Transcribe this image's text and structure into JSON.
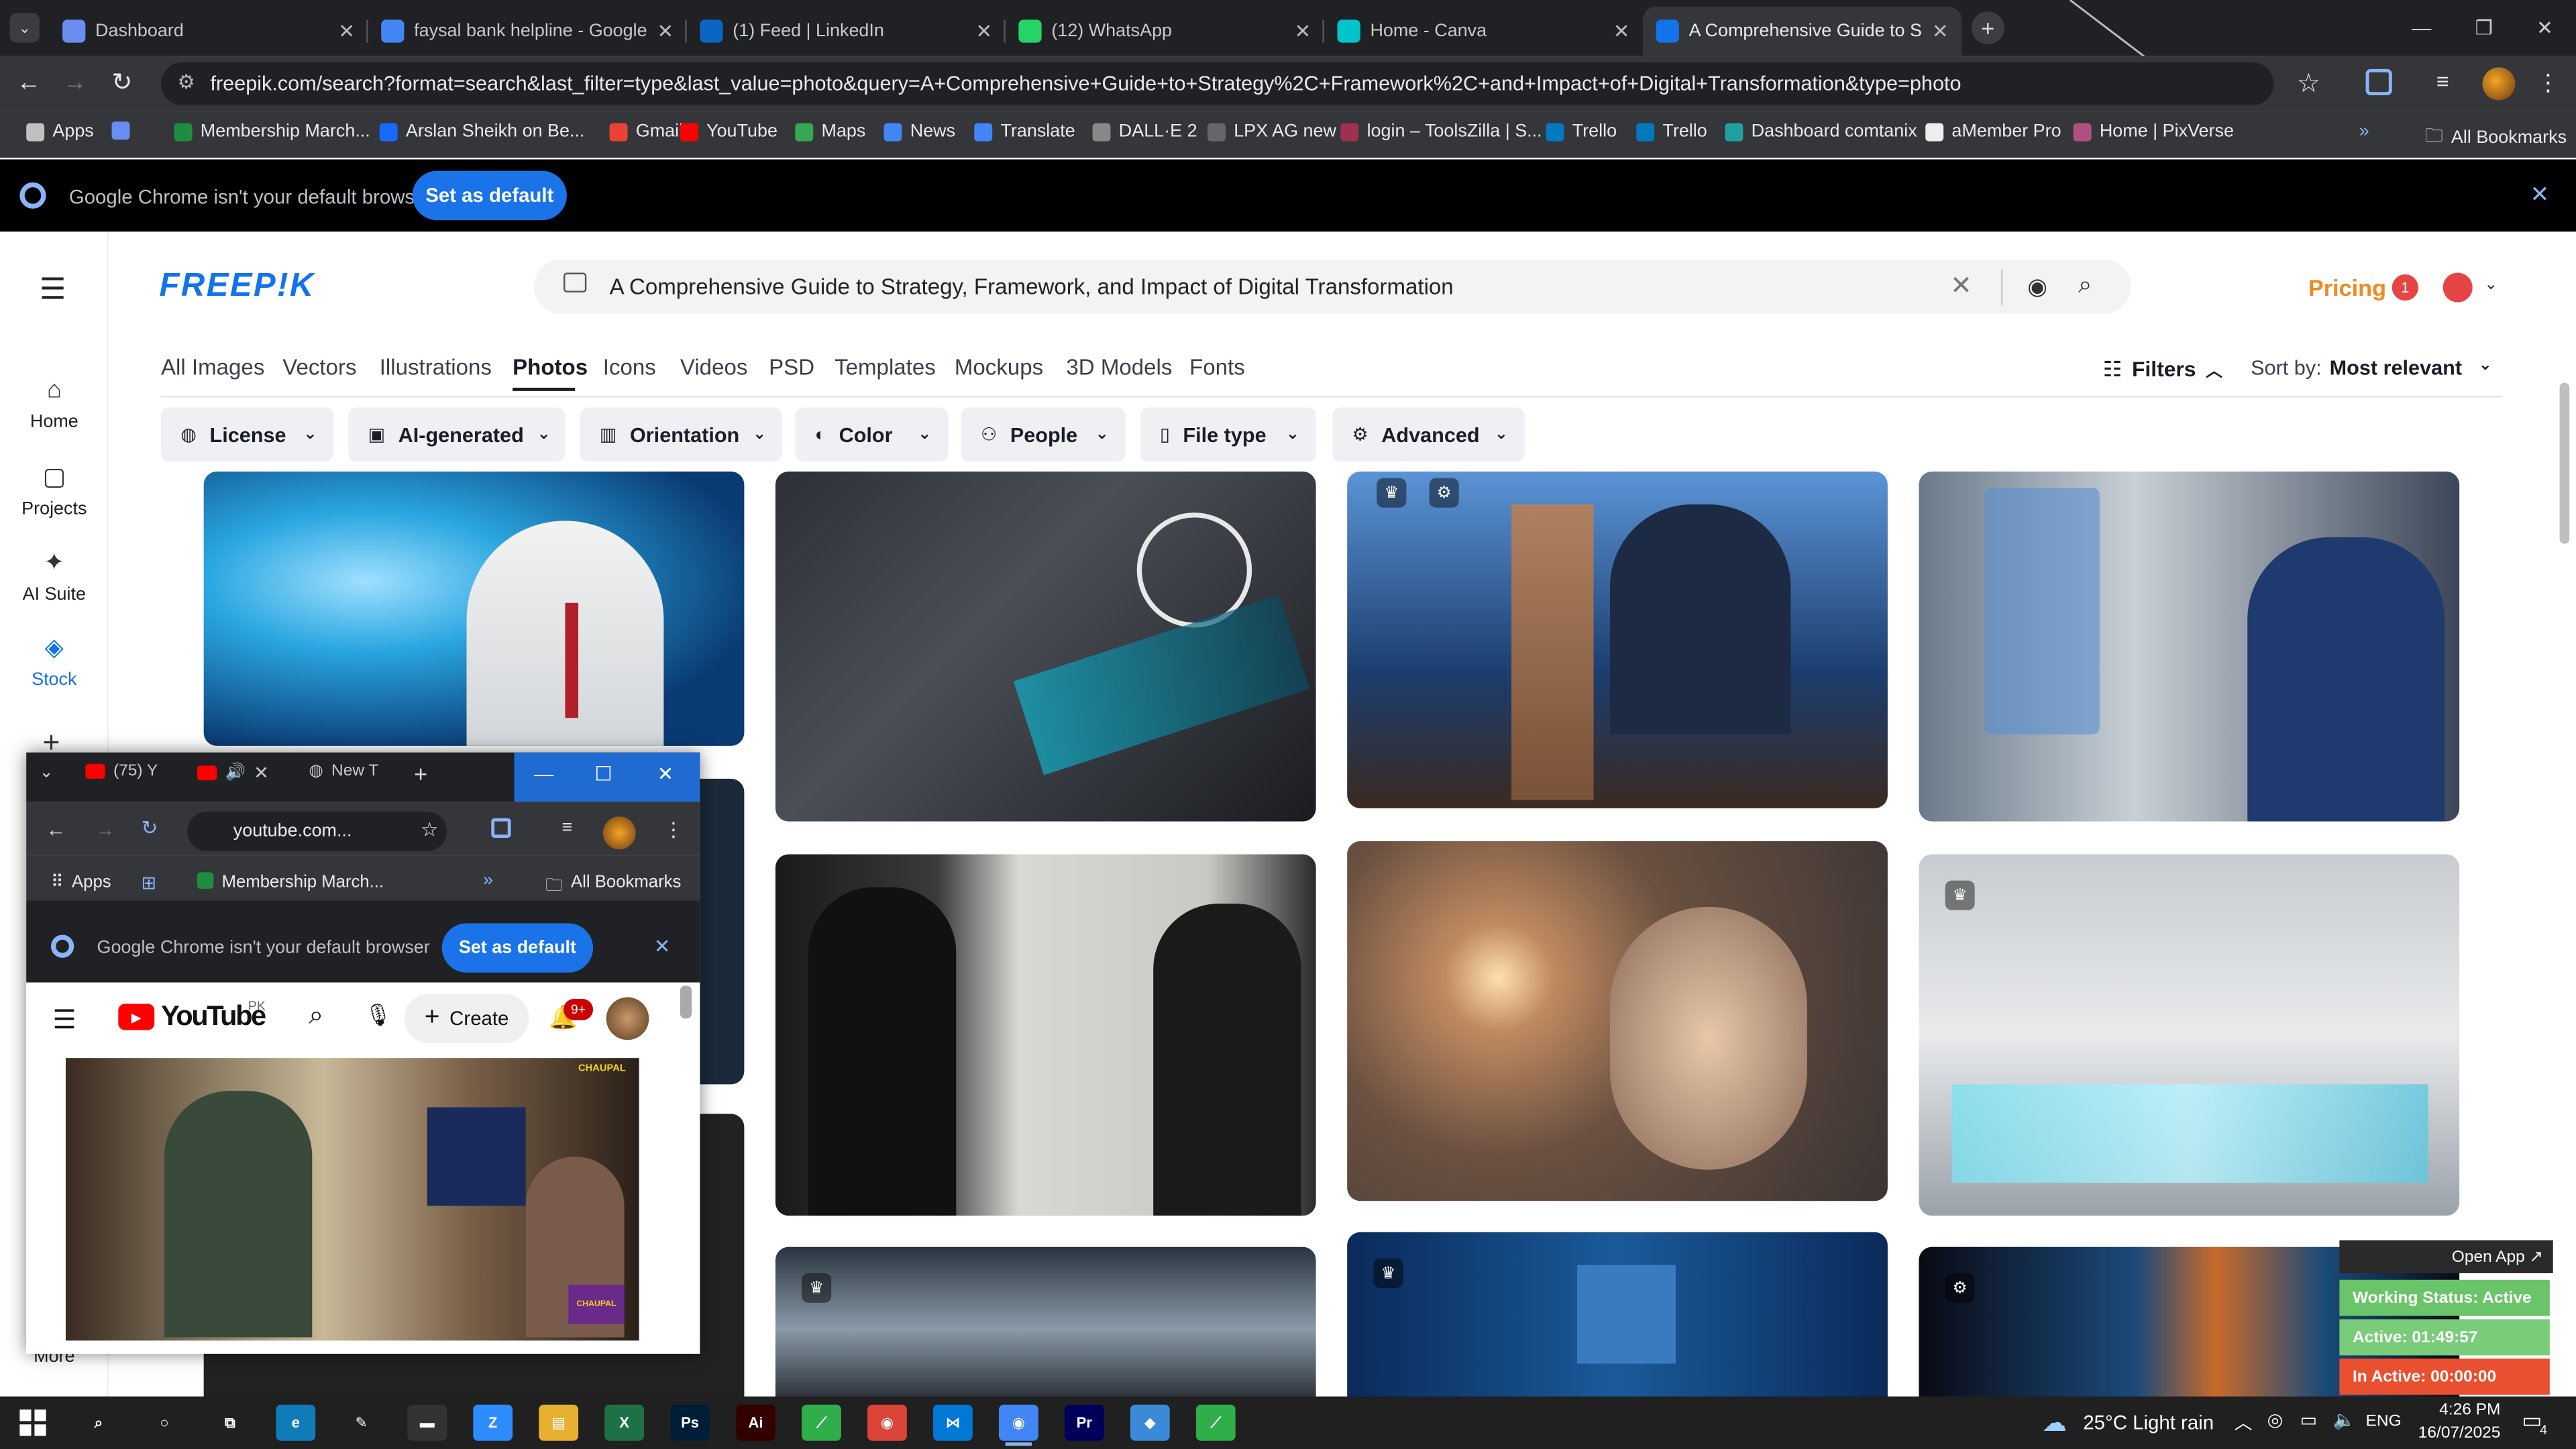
{
  "browser": {
    "tabs": [
      {
        "title": "Dashboard",
        "icon": "globe-icon",
        "color": "#6a8df2"
      },
      {
        "title": "faysal bank helpline - Google S",
        "icon": "google-icon",
        "color": "#4285f4"
      },
      {
        "title": "(1) Feed | LinkedIn",
        "icon": "linkedin-icon",
        "color": "#0a66c2"
      },
      {
        "title": "(12) WhatsApp",
        "icon": "whatsapp-icon",
        "color": "#25d366"
      },
      {
        "title": "Home - Canva",
        "icon": "canva-icon",
        "color": "#00c4cc"
      },
      {
        "title": "A Comprehensive Guide to Stra",
        "icon": "freepik-icon",
        "color": "#1273eb"
      }
    ],
    "new_tab": "+",
    "url": "freepik.com/search?format=search&last_filter=type&last_value=photo&query=A+Comprehensive+Guide+to+Strategy%2C+Framework%2C+and+Impact+of+Digital+Transformation&type=photo",
    "bookmarks": [
      {
        "label": "Apps",
        "color": "#c0c0c0"
      },
      {
        "label": "",
        "color": "#6a8df2"
      },
      {
        "label": "Membership March...",
        "color": "#1e8e3e"
      },
      {
        "label": "Arslan Sheikh on Be...",
        "color": "#1769ff"
      },
      {
        "label": "Gmail",
        "color": "#ea4335"
      },
      {
        "label": "YouTube",
        "color": "#ff0000"
      },
      {
        "label": "Maps",
        "color": "#34a853"
      },
      {
        "label": "News",
        "color": "#4285f4"
      },
      {
        "label": "Translate",
        "color": "#4285f4"
      },
      {
        "label": "DALL·E 2",
        "color": "#888888"
      },
      {
        "label": "LPX AG new",
        "color": "#666666"
      },
      {
        "label": "login – ToolsZilla | S...",
        "color": "#a03050"
      },
      {
        "label": "Trello",
        "color": "#0079bf"
      },
      {
        "label": "Trello",
        "color": "#0079bf"
      },
      {
        "label": "Dashboard comtanix",
        "color": "#20a0a0"
      },
      {
        "label": "aMember Pro",
        "color": "#eeeeee"
      },
      {
        "label": "Home | PixVerse",
        "color": "#b05080"
      }
    ],
    "bookmarks_more": "»",
    "all_bookmarks": "All Bookmarks",
    "infobar_text": "Google Chrome isn't your default browser",
    "set_default": "Set as default"
  },
  "freepik": {
    "logo": "FREEP!K",
    "search_query": "A Comprehensive Guide to Strategy, Framework, and Impact of Digital Transformation",
    "pricing": "Pricing",
    "notif_count": "1",
    "sidebar": [
      {
        "label": "Home",
        "glyph": "⌂"
      },
      {
        "label": "Projects",
        "glyph": "▢"
      },
      {
        "label": "AI Suite",
        "glyph": "✦"
      },
      {
        "label": "Stock",
        "glyph": "◈"
      }
    ],
    "more": "More",
    "type_tabs": [
      "All Images",
      "Vectors",
      "Illustrations",
      "Photos",
      "Icons",
      "Videos",
      "PSD",
      "Templates",
      "Mockups",
      "3D Models",
      "Fonts"
    ],
    "active_tab": "Photos",
    "filters_label": "Filters",
    "sort_label": "Sort by:",
    "sort_value": "Most relevant",
    "filter_chips": [
      "License",
      "AI-generated",
      "Orientation",
      "Color",
      "People",
      "File type",
      "Advanced"
    ]
  },
  "popup": {
    "tabs": [
      "(75) Y",
      "",
      "New T"
    ],
    "url": "youtube.com...",
    "bookmarks": [
      "Apps",
      "Membership March..."
    ],
    "more": "»",
    "all_bookmarks": "All Bookmarks",
    "infobar_text": "Google Chrome isn't your default browser",
    "set_default": "Set as default",
    "yt_logo": "YouTube",
    "yt_region": "PK",
    "create": "Create",
    "notif_badge": "9+",
    "video_watermark": "CHAUPAL"
  },
  "widget": {
    "open_app": "Open App ↗",
    "working_status": "Working Status: Active",
    "active": "Active: 01:49:57",
    "inactive": "In Active: 00:00:00"
  },
  "taskbar": {
    "weather": "25°C  Light rain",
    "lang": "ENG",
    "time": "4:26 PM",
    "date": "16/07/2025",
    "notification_count": "4"
  }
}
